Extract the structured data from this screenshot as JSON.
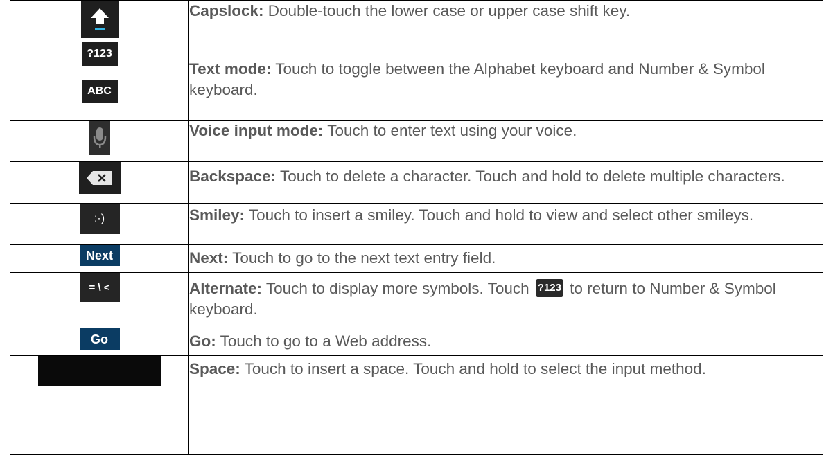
{
  "rows": [
    {
      "icon": "capslock-key-icon",
      "key_text": "",
      "term": "Capslock:",
      "text": " Double-touch the lower case or upper case shift key."
    },
    {
      "icon": "text-mode-keys-icon",
      "key_text": "?123",
      "key_text_2": "ABC",
      "term": "Text mode:",
      "text": " Touch to toggle between the Alphabet keyboard and Number & Symbol keyboard."
    },
    {
      "icon": "microphone-key-icon",
      "key_text": "",
      "term": "Voice input mode:",
      "text": " Touch to enter text using your voice."
    },
    {
      "icon": "backspace-key-icon",
      "key_text": "",
      "term": "Backspace:",
      "text": " Touch to delete a character. Touch and hold to delete multiple characters."
    },
    {
      "icon": "smiley-key-icon",
      "key_text": ":-)",
      "term": "Smiley:",
      "text": " Touch to insert a smiley. Touch and hold to view and select other smileys."
    },
    {
      "icon": "next-key-icon",
      "key_text": "Next",
      "term": "Next:",
      "text": " Touch to go to the next text entry field."
    },
    {
      "icon": "alternate-key-icon",
      "key_text": "= \\ <",
      "term": "Alternate:",
      "text_before": " Touch to display more symbols. Touch ",
      "inline_key": "?123",
      "text_after": " to return to Number & Symbol keyboard."
    },
    {
      "icon": "go-key-icon",
      "key_text": "Go",
      "term": "Go:",
      "text": " Touch to go to a Web address."
    },
    {
      "icon": "space-key-icon",
      "key_text": "",
      "term": "Space:",
      "text": " Touch to insert a space. Touch and hold to select the input method."
    }
  ]
}
